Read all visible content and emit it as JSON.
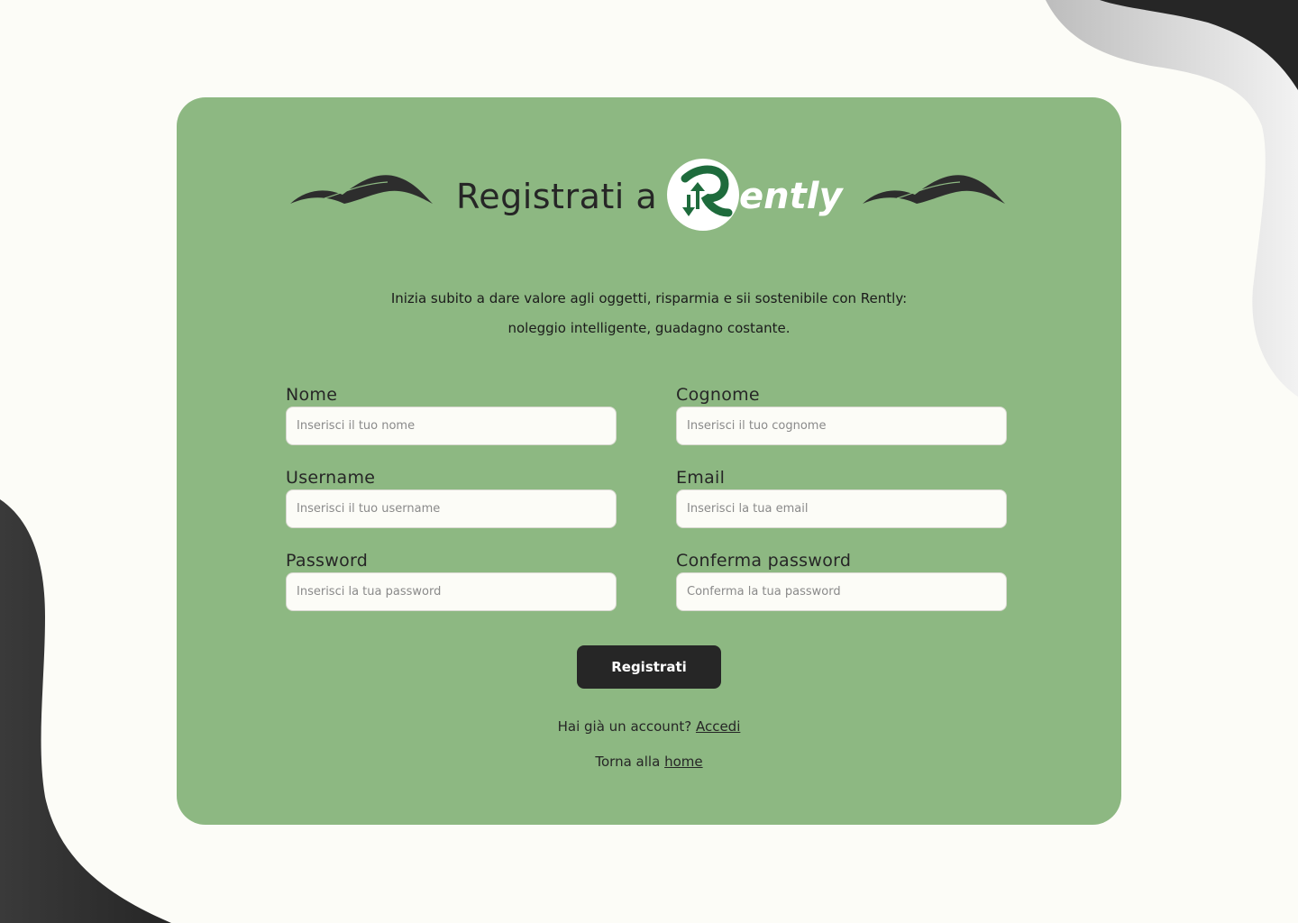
{
  "header": {
    "title": "Registrati a",
    "logo_text": "ently"
  },
  "intro": {
    "line1": "Inizia subito a dare valore agli oggetti, risparmia e sii sostenibile con Rently:",
    "line2": "noleggio intelligente, guadagno costante."
  },
  "form": {
    "first_name": {
      "label": "Nome",
      "placeholder": "Inserisci il tuo nome"
    },
    "last_name": {
      "label": "Cognome",
      "placeholder": "Inserisci il tuo cognome"
    },
    "username": {
      "label": "Username",
      "placeholder": "Inserisci il tuo username"
    },
    "email": {
      "label": "Email",
      "placeholder": "Inserisci la tua email"
    },
    "password": {
      "label": "Password",
      "placeholder": "Inserisci la tua password"
    },
    "confirm_password": {
      "label": "Conferma password",
      "placeholder": "Conferma la tua password"
    },
    "submit_label": "Registrati"
  },
  "footer": {
    "login_prompt": "Hai già un account?",
    "login_link": "Accedi",
    "home_prompt": "Torna alla",
    "home_link": "home"
  },
  "colors": {
    "page_background": "#fcfcf7",
    "card_background": "#8db882",
    "dark": "#262626",
    "logo_green": "#1e6b3c",
    "input_background": "#fcfcf7"
  },
  "icons": [
    "wave-decoration-icon",
    "rently-logo-icon"
  ]
}
